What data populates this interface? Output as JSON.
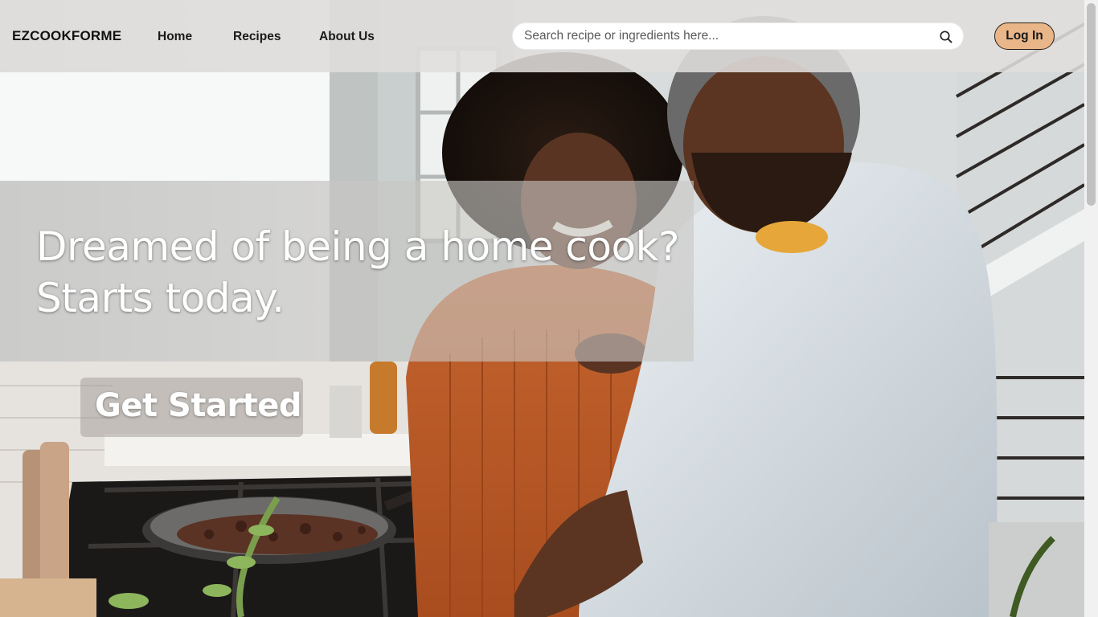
{
  "navbar": {
    "brand": "EZCOOKFORME",
    "links": [
      "Home",
      "Recipes",
      "About Us"
    ],
    "search_placeholder": "Search recipe or ingredients here...",
    "search_icon": "search-icon",
    "login_label": "Log In"
  },
  "hero": {
    "heading_line1": "Dreamed of being a home cook?",
    "heading_line2": "Starts today.",
    "cta_label": "Get Started",
    "image_description": "hero-cooking-photo"
  },
  "colors": {
    "accent": "#e8b688",
    "navbar_bg": "#e0dedc",
    "text": "#1a1a1a"
  }
}
